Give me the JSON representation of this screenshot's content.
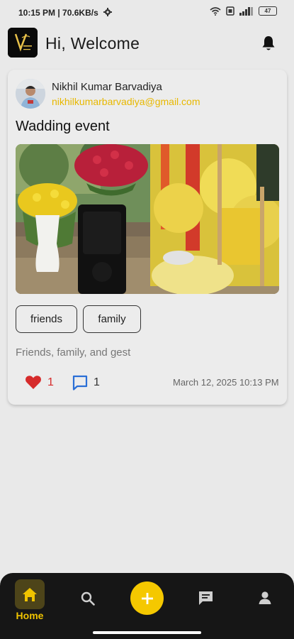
{
  "status_bar": {
    "time_speed": "10:15 PM | 70.6KB/s",
    "battery": "47"
  },
  "header": {
    "title": "Hi, Welcome",
    "logo_icon": "vivah-logo"
  },
  "post": {
    "author_name": "Nikhil Kumar Barvadiya",
    "author_email": "nikhilkumarbarvadiya@gmail.com",
    "title": "Wadding event",
    "tags": [
      "friends",
      "family"
    ],
    "description": "Friends, family, and gest",
    "likes": "1",
    "comments": "1",
    "timestamp": "March 12, 2025 10:13 PM"
  },
  "nav": {
    "home_label": "Home",
    "items": [
      "home-icon",
      "search-icon",
      "add-icon",
      "chat-icon",
      "profile-icon"
    ]
  },
  "colors": {
    "accent": "#f5c800",
    "like": "#d62b2b",
    "comment": "#2a6fd6"
  }
}
